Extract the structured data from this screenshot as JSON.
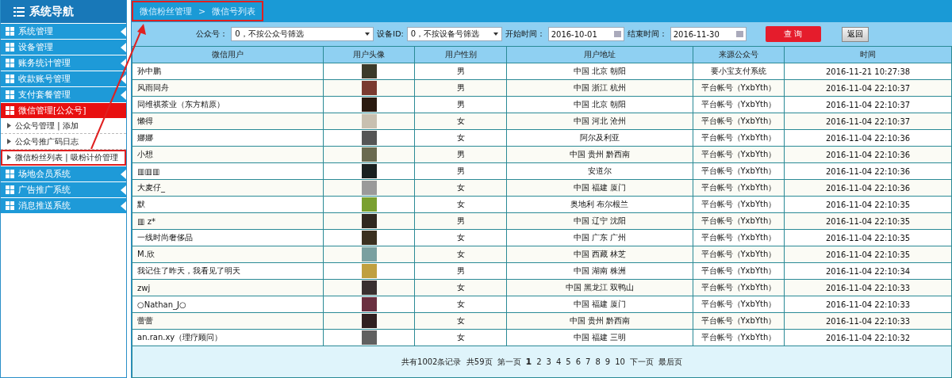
{
  "sidebar": {
    "title": "系统导航",
    "items": [
      {
        "label": "系统管理",
        "selected": false
      },
      {
        "label": "设备管理",
        "selected": false
      },
      {
        "label": "账务统计管理",
        "selected": false
      },
      {
        "label": "收款账号管理",
        "selected": false
      },
      {
        "label": "支付套餐管理",
        "selected": false
      },
      {
        "label": "微信管理[公众号]",
        "selected": true,
        "expanded": true,
        "children": [
          {
            "label": "公众号管理 | 添加",
            "annotated": false
          },
          {
            "label": "公众号推广码日志",
            "annotated": false
          },
          {
            "label": "微信粉丝列表 | 吸粉计价管理",
            "annotated": true
          }
        ]
      },
      {
        "label": "场地会员系统",
        "selected": false
      },
      {
        "label": "广告推广系统",
        "selected": false
      },
      {
        "label": "消息推送系统",
        "selected": false
      }
    ]
  },
  "breadcrumb": {
    "items": [
      "微信粉丝管理",
      "微信号列表"
    ],
    "separator": ">",
    "annotated": true
  },
  "filters": {
    "account_label": "公众号：",
    "account_value": "0，不按公众号筛选",
    "device_label": "设备ID:",
    "device_value": "0，不按设备号筛选",
    "start_label": "开始时间：",
    "start_value": "2016-10-01",
    "end_label": "结束时间：",
    "end_value": "2016-11-30",
    "search_button": "查 询",
    "back_button": "返回"
  },
  "table": {
    "columns": [
      "微信用户",
      "用户头像",
      "用户性别",
      "用户地址",
      "来源公众号",
      "时间"
    ],
    "rows": [
      {
        "user": "孙中鹏",
        "gender": "男",
        "address": "中国 北京 朝阳",
        "source": "要小宝支付系统",
        "time": "2016-11-21 10:27:38"
      },
      {
        "user": "风雨同舟",
        "gender": "男",
        "address": "中国 浙江 杭州",
        "source": "平台帐号（YxbYth）",
        "time": "2016-11-04 22:10:37"
      },
      {
        "user": "同维祺茶业（东方精原）",
        "gender": "男",
        "address": "中国 北京 朝阳",
        "source": "平台帐号（YxbYth）",
        "time": "2016-11-04 22:10:37"
      },
      {
        "user": "懒得",
        "gender": "女",
        "address": "中国 河北 沧州",
        "source": "平台帐号（YxbYth）",
        "time": "2016-11-04 22:10:37"
      },
      {
        "user": "娜娜",
        "gender": "女",
        "address": "阿尔及利亚",
        "source": "平台帐号（YxbYth）",
        "time": "2016-11-04 22:10:36"
      },
      {
        "user": "小想",
        "gender": "男",
        "address": "中国 贵州 黔西南",
        "source": "平台帐号（YxbYth）",
        "time": "2016-11-04 22:10:36"
      },
      {
        "user": "▥▥▥",
        "gender": "男",
        "address": "安道尔",
        "source": "平台帐号（YxbYth）",
        "time": "2016-11-04 22:10:36"
      },
      {
        "user": "大麦仔_",
        "gender": "女",
        "address": "中国 福建 厦门",
        "source": "平台帐号（YxbYth）",
        "time": "2016-11-04 22:10:36"
      },
      {
        "user": "默",
        "gender": "女",
        "address": "奥地利 布尔根兰",
        "source": "平台帐号（YxbYth）",
        "time": "2016-11-04 22:10:35"
      },
      {
        "user": "▥ z*",
        "gender": "男",
        "address": "中国 辽宁 沈阳",
        "source": "平台帐号（YxbYth）",
        "time": "2016-11-04 22:10:35"
      },
      {
        "user": "一线时尚奢侈品",
        "gender": "女",
        "address": "中国 广东 广州",
        "source": "平台帐号（YxbYth）",
        "time": "2016-11-04 22:10:35"
      },
      {
        "user": "M.欣",
        "gender": "女",
        "address": "中国 西藏 林芝",
        "source": "平台帐号（YxbYth）",
        "time": "2016-11-04 22:10:35"
      },
      {
        "user": "我记住了昨天，我看见了明天",
        "gender": "男",
        "address": "中国 湖南 株洲",
        "source": "平台帐号（YxbYth）",
        "time": "2016-11-04 22:10:34"
      },
      {
        "user": "zwj",
        "gender": "女",
        "address": "中国 黑龙江 双鸭山",
        "source": "平台帐号（YxbYth）",
        "time": "2016-11-04 22:10:33"
      },
      {
        "user": "○Nathan_J○",
        "gender": "女",
        "address": "中国 福建 厦门",
        "source": "平台帐号（YxbYth）",
        "time": "2016-11-04 22:10:33"
      },
      {
        "user": "蕾蕾",
        "gender": "女",
        "address": "中国 贵州 黔西南",
        "source": "平台帐号（YxbYth）",
        "time": "2016-11-04 22:10:33"
      },
      {
        "user": "an.ran.xy（理疗顾问）",
        "gender": "女",
        "address": "中国 福建 三明",
        "source": "平台帐号（YxbYth）",
        "time": "2016-11-04 22:10:32"
      }
    ]
  },
  "pagination": {
    "summary": "共有1002条记录  共59页",
    "first": "第一页",
    "pages": [
      {
        "label": "1",
        "selected": true
      },
      {
        "label": "2",
        "selected": false
      },
      {
        "label": "3",
        "selected": false
      },
      {
        "label": "4",
        "selected": false
      },
      {
        "label": "5",
        "selected": false
      },
      {
        "label": "6",
        "selected": false
      },
      {
        "label": "7",
        "selected": false
      },
      {
        "label": "8",
        "selected": false
      },
      {
        "label": "9",
        "selected": false
      },
      {
        "label": "10",
        "selected": false
      }
    ],
    "next": "下一页",
    "last": "最后页"
  }
}
